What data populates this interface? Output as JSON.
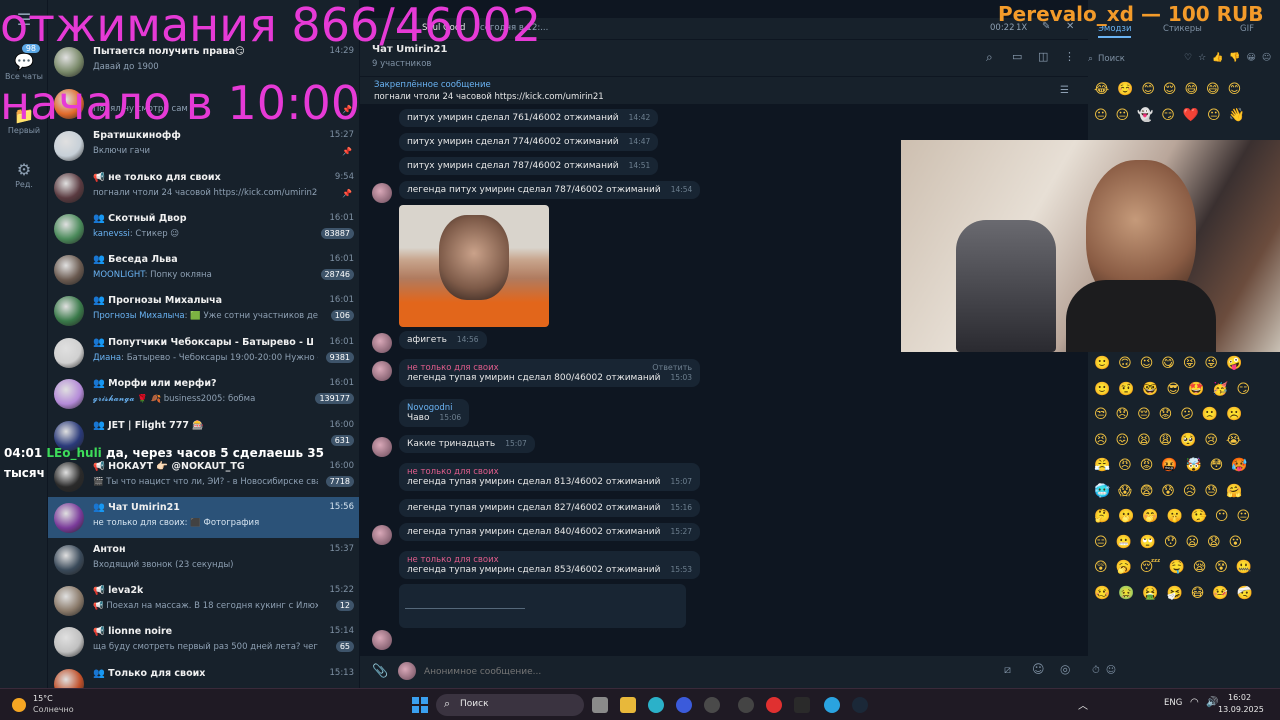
{
  "overlay": {
    "line1": "отжимания 866/46002",
    "line2": "начало в 10:00",
    "donate": "Perevalo_xd — 100 RUB",
    "ticker_time": "04:01",
    "ticker_user": "LEo_huli",
    "ticker_text": "да, через часов 5 сделаешь 35",
    "ticker_text2": "тысяч"
  },
  "rail": [
    {
      "label": "Все чаты",
      "badge": "98",
      "icon": "chat-bubbles-icon"
    },
    {
      "label": "Первый",
      "icon": "folder-icon"
    },
    {
      "label": "Ред.",
      "icon": "sliders-icon"
    }
  ],
  "chats": [
    {
      "title": "Пытается получить права😏",
      "time": "14:29",
      "who": "",
      "snippet": "Давай до 1900",
      "badge": ""
    },
    {
      "title": "",
      "time": "",
      "who": "",
      "snippet": "Понял ну смотри сам",
      "badge": "",
      "pin": true
    },
    {
      "title": "Братишкинофф",
      "time": "15:27",
      "who": "",
      "snippet": "Включи гачи",
      "badge": "",
      "pin": true
    },
    {
      "title": "📢 не только для своих",
      "time": "9:54",
      "who": "",
      "snippet": "погнали чтоли 24 часовой https://kick.com/umirin21",
      "badge": "",
      "pin": true
    },
    {
      "title": "👥 Скотный Двор",
      "time": "16:01",
      "who": "kanevssi",
      "snippet": ": Стикер 😉",
      "badge": "83887"
    },
    {
      "title": "👥 Беседа Льва",
      "time": "16:01",
      "who": "MOONLIGHT",
      "snippet": ": Попку окляна",
      "badge": "28746"
    },
    {
      "title": "👥 Прогнозы Михалыча",
      "time": "16:01",
      "who": "Прогнозы Михалыча",
      "snippet": ": 🟩 Уже сотни участников делятс...",
      "badge": "106"
    },
    {
      "title": "👥 Попутчики Чебоксары - Батырево - Шемурша",
      "time": "16:01",
      "who": "Диана",
      "snippet": ": Батырево - Чебоксары 19:00-20:00  Нужно одно ...",
      "badge": "9381"
    },
    {
      "title": "👥 Морфи или мерфи?",
      "time": "16:01",
      "who": "𝓰𝓻𝓲𝓼𝓱𝓪𝓷𝓰𝓪",
      "snippet": " 🌹 🍂 business2005: бобма",
      "badge": "139177"
    },
    {
      "title": "👥 JET | Flight 777 🎰",
      "time": "16:00",
      "who": "",
      "snippet": "",
      "badge": "631"
    },
    {
      "title": "📢 НОКАУТ 👉🏻 @NOKAUT_TG",
      "time": "16:00",
      "who": "",
      "snippet": "🎬 Ты что нацист что ли, ЭЙ? - в Новосибирске свадеб...",
      "badge": "7718"
    },
    {
      "title": "👥 Чат Umirin21",
      "time": "15:56",
      "who": "",
      "snippet": "не только для своих: ⬛ Фотография",
      "badge": "",
      "active": true
    },
    {
      "title": "Антон",
      "time": "15:37",
      "who": "",
      "snippet": "Входящий звонок (23 секунды)",
      "badge": ""
    },
    {
      "title": "📢 leva2k",
      "time": "15:22",
      "who": "",
      "snippet": "📢 Поехал на массаж. В 18 сегодня кукинг с Илюхой и М...",
      "badge": "12"
    },
    {
      "title": "📢 lionne noire",
      "time": "15:14",
      "who": "",
      "snippet": "ща буду смотреть первый раз 500 дней лета? чего ожид...",
      "badge": "65"
    },
    {
      "title": "👥 Только для своих",
      "time": "15:13",
      "who": "",
      "snippet": "",
      "badge": ""
    }
  ],
  "header": {
    "title": "Чат Umirin21",
    "subtitle": "9 участников",
    "player_time": "00:22",
    "player_speed": "1X",
    "player_track": "Soul Good",
    "player_track2": "сегодня в 12:..."
  },
  "pinned": {
    "label": "Закреплённое сообщение",
    "text": "погнали чтоли 24 часовой https://kick.com/umirin21"
  },
  "messages": [
    {
      "text": "питух умирин сделал 761/46002 отжиманий",
      "time": "14:42"
    },
    {
      "text": "питух умирин сделал 774/46002 отжиманий",
      "time": "14:47"
    },
    {
      "text": "питух умирин сделал 787/46002 отжиманий",
      "time": "14:51"
    },
    {
      "text": "легенда питух умирин сделал 787/46002 отжиманий",
      "time": "14:54"
    },
    {
      "text": "афигеть",
      "time": "14:56"
    },
    {
      "sender": "не только для своих",
      "reply": "Ответить",
      "text": "легенда тупая умирин сделал 800/46002 отжиманий",
      "time": "15:03"
    },
    {
      "sender": "Novogodni",
      "text": "Чаво",
      "time": "15:06"
    },
    {
      "text": "Какие тринадцать",
      "time": "15:07"
    },
    {
      "sender": "не только для своих",
      "text": "легенда тупая умирин сделал 813/46002 отжиманий",
      "time": "15:07"
    },
    {
      "text": "легенда тупая умирин сделал 827/46002 отжиманий",
      "time": "15:16"
    },
    {
      "text": "легенда тупая умирин сделал 840/46002 отжиманий",
      "time": "15:27"
    },
    {
      "sender": "не только для своих",
      "text": "легенда тупая умирин сделал 853/46002 отжиманий",
      "time": "15:53"
    }
  ],
  "compose": {
    "placeholder": "Анонимное сообщение..."
  },
  "emoji": {
    "tabs": [
      "Эмодзи",
      "Стикеры",
      "GIF"
    ],
    "search": "Поиск",
    "rows": [
      "😂☺️😊😌😄😄😊",
      "😐😐👻😏❤️😐👋",
      "🙂🙃😉😋😝😜🤪",
      "🙂🤨🤓😎🤩🥳😏",
      "😒😞😔😟😕🙁☹️",
      "😣😖😫😩🥺😢😭",
      "😤😠😡🤬🤯😳🥵",
      "🥶😱😨😰😥😓🤗",
      "🤔🫢🤭🤫🤥😶😐",
      "😑😬🙄😯😦😧😮",
      "😲🥱😴🤤😪😵🤐",
      "🥴🤢🤮🤧😷🤒🤕"
    ]
  },
  "taskbar": {
    "weather_temp": "15°C",
    "weather_desc": "Солнечно",
    "search": "Поиск",
    "lang": "ENG",
    "time": "16:02",
    "date": "13.09.2025"
  }
}
